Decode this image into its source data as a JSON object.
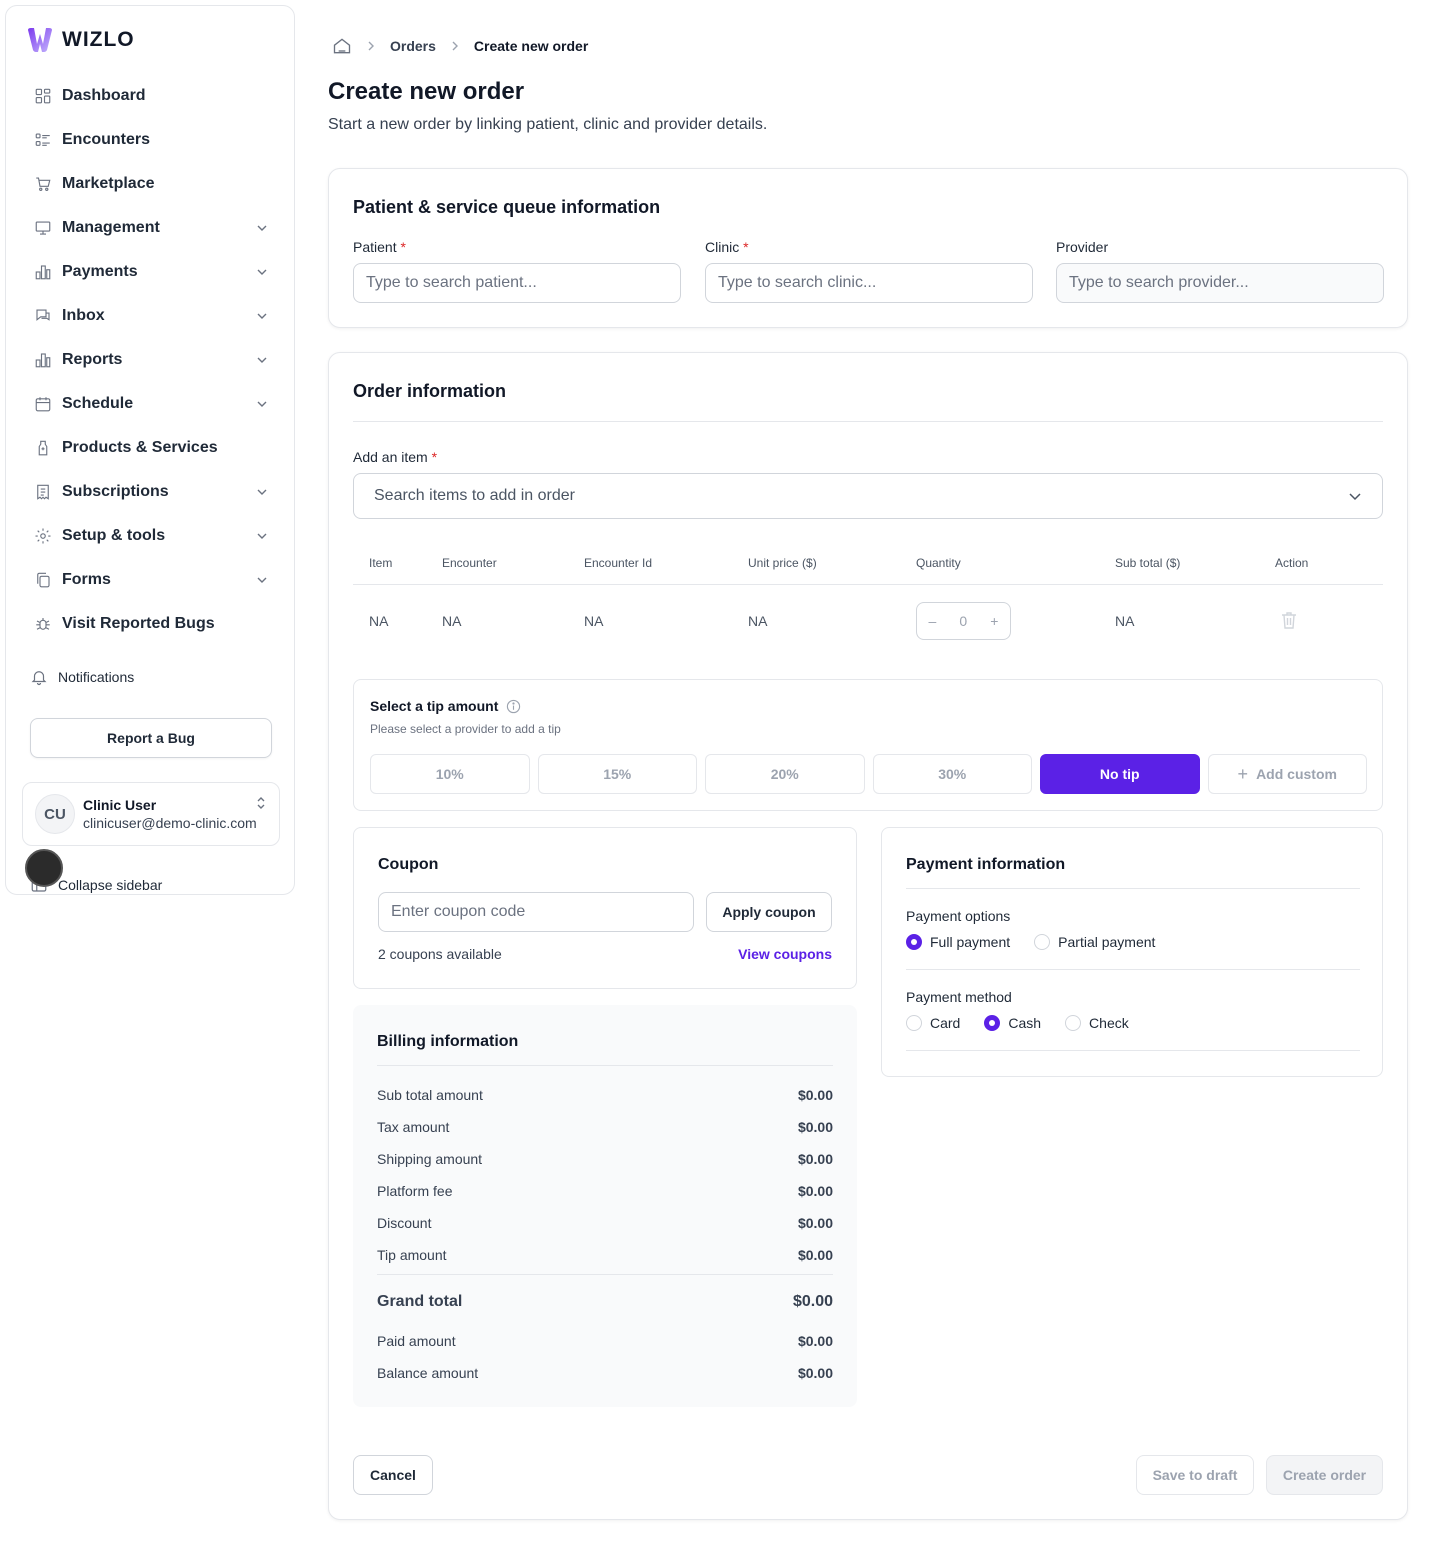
{
  "brand": {
    "name": "WIZLO",
    "accent": "#5b21e6",
    "logo_gradient": [
      "#8b5cf6",
      "#c4b5fd"
    ]
  },
  "sidebar": {
    "items": [
      {
        "label": "Dashboard",
        "icon": "dashboard-icon",
        "has_chevron": false
      },
      {
        "label": "Encounters",
        "icon": "list-icon",
        "has_chevron": false
      },
      {
        "label": "Marketplace",
        "icon": "cart-icon",
        "has_chevron": false
      },
      {
        "label": "Management",
        "icon": "monitor-icon",
        "has_chevron": true
      },
      {
        "label": "Payments",
        "icon": "bar-chart-icon",
        "has_chevron": true
      },
      {
        "label": "Inbox",
        "icon": "chat-icon",
        "has_chevron": true
      },
      {
        "label": "Reports",
        "icon": "bar-chart-icon",
        "has_chevron": true
      },
      {
        "label": "Schedule",
        "icon": "calendar-icon",
        "has_chevron": true
      },
      {
        "label": "Products & Services",
        "icon": "bottle-icon",
        "has_chevron": false
      },
      {
        "label": "Subscriptions",
        "icon": "receipt-icon",
        "has_chevron": true
      },
      {
        "label": "Setup & tools",
        "icon": "gear-icon",
        "has_chevron": true
      },
      {
        "label": "Forms",
        "icon": "copy-icon",
        "has_chevron": true
      },
      {
        "label": "Visit Reported Bugs",
        "icon": "bug-icon",
        "has_chevron": false
      }
    ],
    "notifications_label": "Notifications",
    "report_bug_label": "Report a Bug",
    "user": {
      "initials": "CU",
      "name": "Clinic User",
      "email": "clinicuser@demo-clinic.com"
    },
    "collapse_label": "Collapse sidebar"
  },
  "breadcrumb": {
    "items": [
      "Orders",
      "Create new order"
    ]
  },
  "page": {
    "title": "Create new order",
    "subtitle": "Start a new order by linking patient, clinic and provider details."
  },
  "patient_section": {
    "title": "Patient & service queue information",
    "patient": {
      "label": "Patient",
      "placeholder": "Type to search patient..."
    },
    "clinic": {
      "label": "Clinic",
      "placeholder": "Type to search clinic..."
    },
    "provider": {
      "label": "Provider",
      "placeholder": "Type to search provider..."
    }
  },
  "order_section": {
    "title": "Order information",
    "add_item_label": "Add an item",
    "add_item_placeholder": "Search items to add in order",
    "table": {
      "headers": [
        "Item",
        "Encounter",
        "Encounter Id",
        "Unit price ($)",
        "Quantity",
        "Sub total ($)",
        "Action"
      ],
      "rows": [
        {
          "item": "NA",
          "encounter": "NA",
          "encounter_id": "NA",
          "unit_price": "NA",
          "quantity": "0",
          "sub_total": "NA"
        }
      ]
    }
  },
  "tip": {
    "title": "Select a tip amount",
    "subtitle": "Please select a provider to add a tip",
    "options": [
      "10%",
      "15%",
      "20%",
      "30%",
      "No tip"
    ],
    "selected": "No tip",
    "custom_label": "Add custom"
  },
  "coupon": {
    "title": "Coupon",
    "placeholder": "Enter coupon code",
    "apply_label": "Apply coupon",
    "available_text": "2 coupons available",
    "view_label": "View coupons"
  },
  "billing": {
    "title": "Billing information",
    "rows": [
      {
        "label": "Sub total amount",
        "value": "$0.00"
      },
      {
        "label": "Tax amount",
        "value": "$0.00"
      },
      {
        "label": "Shipping amount",
        "value": "$0.00"
      },
      {
        "label": "Platform fee",
        "value": "$0.00"
      },
      {
        "label": "Discount",
        "value": "$0.00"
      },
      {
        "label": "Tip amount",
        "value": "$0.00"
      }
    ],
    "grand_total": {
      "label": "Grand total",
      "value": "$0.00"
    },
    "rows2": [
      {
        "label": "Paid amount",
        "value": "$0.00"
      },
      {
        "label": "Balance amount",
        "value": "$0.00"
      }
    ]
  },
  "payment": {
    "title": "Payment information",
    "options_label": "Payment options",
    "options": [
      {
        "label": "Full payment",
        "checked": true
      },
      {
        "label": "Partial payment",
        "checked": false
      }
    ],
    "method_label": "Payment method",
    "methods": [
      {
        "label": "Card",
        "checked": false
      },
      {
        "label": "Cash",
        "checked": true
      },
      {
        "label": "Check",
        "checked": false
      }
    ]
  },
  "actions": {
    "cancel": "Cancel",
    "save_draft": "Save to draft",
    "create": "Create order"
  }
}
